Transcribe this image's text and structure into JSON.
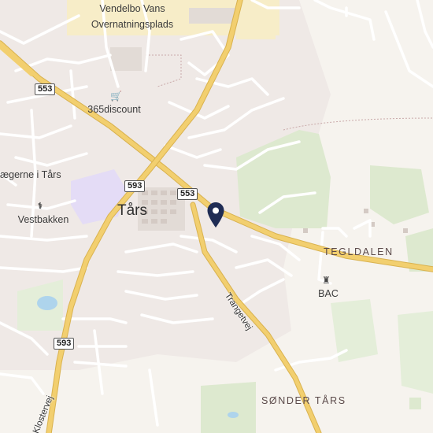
{
  "map": {
    "places": {
      "vendelbo_line1": "Vendelbo Vans",
      "vendelbo_line2": "Overnatningsplads",
      "discount": "365discount",
      "laegerne": "ægerne i Tårs",
      "vestbakken": "Vestbakken",
      "bac": "BAC"
    },
    "town": "Tårs",
    "districts": {
      "tegldalen": "TEGLDALEN",
      "sonder_tars": "SØNDER TÅRS"
    },
    "roads": {
      "trangetvej": "Trangetvej",
      "klostervej": "Klostervej"
    },
    "shields": {
      "a": "553",
      "b": "593",
      "c": "553",
      "d": "593"
    },
    "icons": {
      "shop": "shopping-cart-icon",
      "doctor": "medical-icon",
      "place": "building-icon",
      "pin": "location-pin-icon"
    },
    "colors": {
      "background": "#f6f3ee",
      "main_road": "#e9c464",
      "pin": "#1f2c54",
      "green": "#dde9cf",
      "water": "#aed4ec"
    }
  }
}
